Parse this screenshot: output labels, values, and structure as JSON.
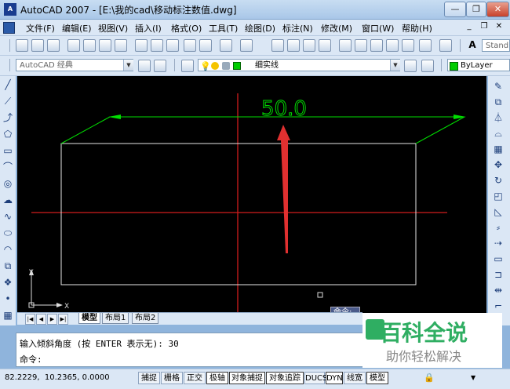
{
  "window": {
    "title": "AutoCAD 2007 - [E:\\我的cad\\移动标注数值.dwg]",
    "minimize": "—",
    "restore": "❐",
    "close": "✕"
  },
  "menu": [
    "文件(F)",
    "编辑(E)",
    "视图(V)",
    "插入(I)",
    "格式(O)",
    "工具(T)",
    "绘图(D)",
    "标注(N)",
    "修改(M)",
    "窗口(W)",
    "帮助(H)"
  ],
  "doc_controls": {
    "minimize": "_",
    "restore": "❐",
    "close": "✕"
  },
  "toolbar": {
    "text_style": "Stand"
  },
  "workspace": {
    "value": "AutoCAD 经典"
  },
  "layer": {
    "value": "细实线"
  },
  "color": {
    "value": "ByLayer"
  },
  "drawing": {
    "dimension_text": "50.0",
    "ucs_x": "X",
    "ucs_y": "Y"
  },
  "tabs": {
    "model": "模型",
    "layout1": "布局1",
    "layout2": "布局2"
  },
  "tooltip": {
    "text": "命令:"
  },
  "command": {
    "history": "输入倾斜角度 (按 ENTER 表示无): 30",
    "prompt": "命令:"
  },
  "status": {
    "coords": "82.2229,  10.2365, 0.0000",
    "buttons": [
      "捕捉",
      "栅格",
      "正交",
      "极轴",
      "对象捕捉",
      "对象追踪",
      "DUCS",
      "DYN",
      "线宽",
      "模型"
    ]
  },
  "watermark": {
    "title": "百科全说",
    "subtitle": "助你轻松解决"
  },
  "colors": {
    "canvas": "#000000",
    "dimension": "#00dd00",
    "geometry": "#e6e6e6",
    "centerline": "#d11c1c",
    "arrow": "#e03030"
  }
}
